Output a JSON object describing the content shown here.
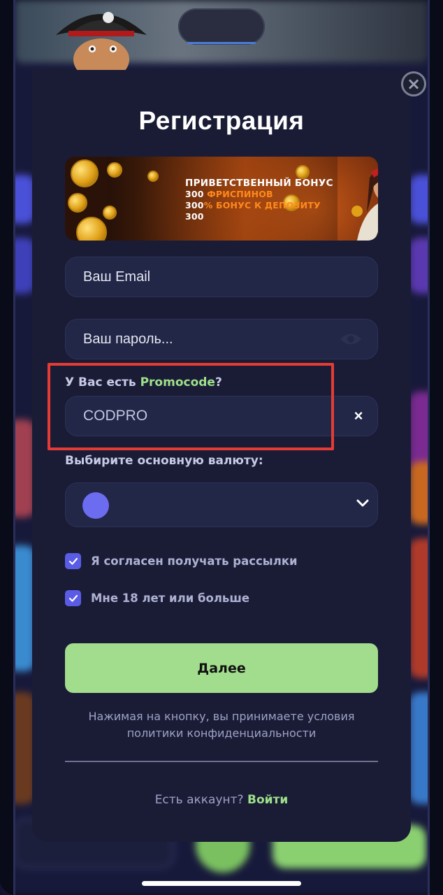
{
  "modal": {
    "title": "Регистрация",
    "close_icon": "close-icon"
  },
  "banner": {
    "line1": "ПРИВЕТСТВЕННЫЙ БОНУС",
    "line2_prefix": "300 ",
    "line2_highlight": "ФРИСПИНОВ",
    "line3_prefix": "300",
    "line3_highlight": "% БОНУС К ДЕПОЗИТУ",
    "line4": "300"
  },
  "email_field": {
    "placeholder": "Ваш Email"
  },
  "password_field": {
    "placeholder": "Ваш пароль...",
    "icon": "eye-icon"
  },
  "promo": {
    "label_prefix": "У Вас есть ",
    "label_highlight": "Promocode",
    "label_suffix": "?",
    "value": "CODPRO",
    "clear_icon": "close-icon"
  },
  "currency": {
    "label": "Выбирите основную валюту:",
    "selected": "",
    "icon": "chevron-down-icon"
  },
  "checkboxes": [
    {
      "label": "Я согласен получать рассылки",
      "checked": true
    },
    {
      "label": "Мне 18 лет или больше",
      "checked": true
    }
  ],
  "next_button": {
    "label": "Далее"
  },
  "terms": {
    "line1": "Нажимая на кнопку, вы принимаете условия",
    "line2": "политики конфиденциальности"
  },
  "login": {
    "prompt": "Есть аккаунт? ",
    "link": "Войти"
  },
  "colors": {
    "modal_bg": "#1a1c36",
    "field_bg": "#222647",
    "accent_green": "#a2dd8d",
    "checkbox_purple": "#5b5ce6",
    "highlight_red": "#e53b35"
  }
}
